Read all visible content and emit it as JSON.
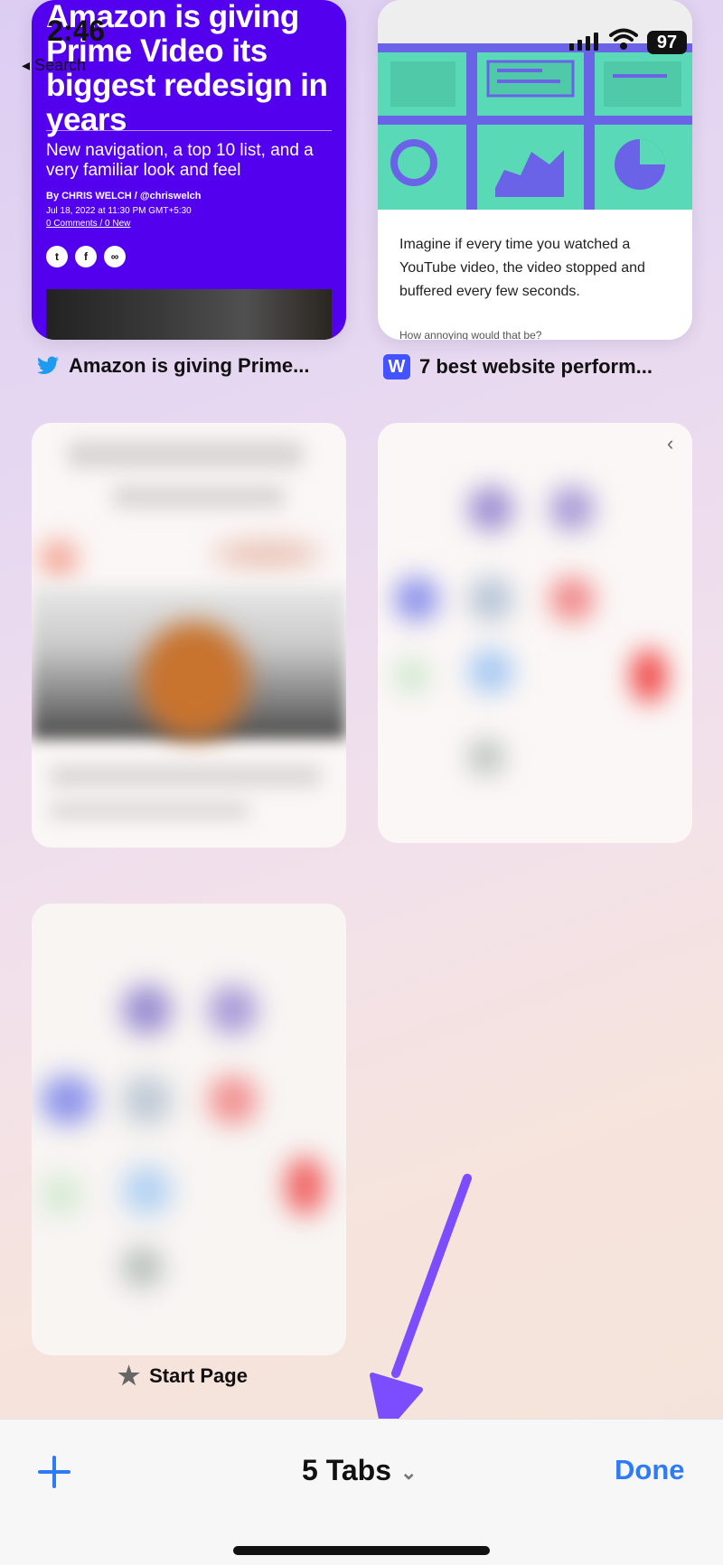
{
  "status_bar": {
    "time": "2:46",
    "back_label": "◂ Search",
    "battery": "97"
  },
  "tabs": [
    {
      "title": "Amazon is giving Prime...",
      "icon": "twitter-icon",
      "preview": {
        "headline": "Amazon is giving Prime Video its biggest redesign in years",
        "subhead": "New navigation, a top 10 list, and a very familiar look and feel",
        "byline": "By CHRIS WELCH / @chriswelch",
        "date": "Jul 18, 2022 at 11:30 PM GMT+5:30",
        "comments": "0 Comments / 0 New"
      }
    },
    {
      "title": "7 best website perform...",
      "icon": "webflow-icon",
      "icon_letter": "W",
      "preview": {
        "body": "Imagine if every time you watched a YouTube video, the video stopped and buffered every few seconds.",
        "more": "How annoying would that be?"
      }
    },
    {
      "title": "",
      "blurred": true
    },
    {
      "title": "",
      "blurred": true
    },
    {
      "title": "Start Page",
      "icon": "star-icon",
      "blurred": true
    }
  ],
  "toolbar": {
    "add_label": "+",
    "tab_count": "5 Tabs",
    "done_label": "Done"
  },
  "colors": {
    "accent": "#2f7bf6",
    "verge_purple": "#5200ee",
    "arrow": "#7b4dff"
  }
}
